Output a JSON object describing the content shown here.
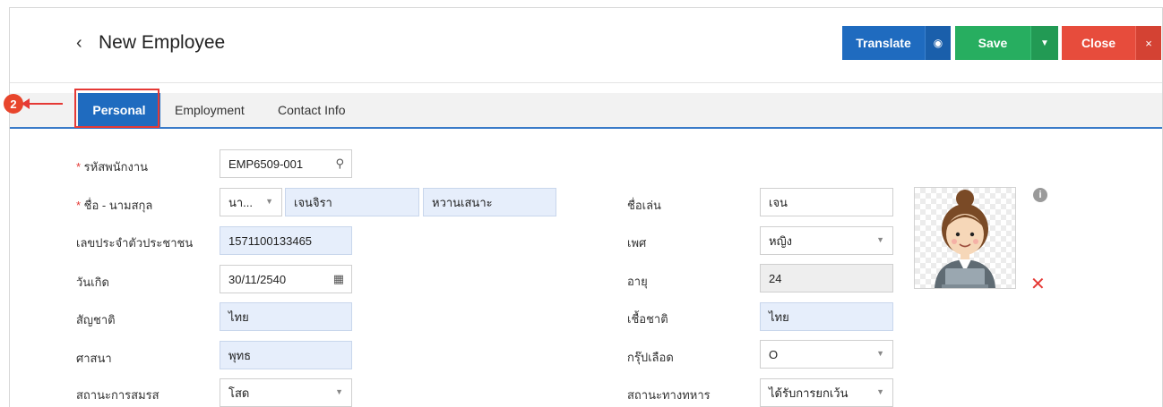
{
  "header": {
    "back_icon": "‹",
    "title": "New Employee",
    "translate_label": "Translate",
    "globe_icon": "◉",
    "save_label": "Save",
    "save_caret": "▼",
    "close_label": "Close",
    "close_x": "×"
  },
  "step_marker": "2",
  "tabs": [
    "Personal",
    "Employment",
    "Contact Info"
  ],
  "form": {
    "emp_code": {
      "label": "รหัสพนักงาน",
      "value": "EMP6509-001"
    },
    "name": {
      "label": "ชื่อ - นามสกุล",
      "prefix": "นา...",
      "first": "เจนจิรา",
      "last": "หวานเสนาะ"
    },
    "id_no": {
      "label": "เลขประจำตัวประชาชน",
      "value": "1571100133465"
    },
    "birth": {
      "label": "วันเกิด",
      "value": "30/11/2540"
    },
    "nationality": {
      "label": "สัญชาติ",
      "value": "ไทย"
    },
    "religion": {
      "label": "ศาสนา",
      "value": "พุทธ"
    },
    "marital": {
      "label": "สถานะการสมรส",
      "value": "โสด"
    },
    "nickname": {
      "label": "ชื่อเล่น",
      "value": "เจน"
    },
    "gender": {
      "label": "เพศ",
      "value": "หญิง"
    },
    "age": {
      "label": "อายุ",
      "value": "24"
    },
    "ethnicity": {
      "label": "เชื้อชาติ",
      "value": "ไทย"
    },
    "blood": {
      "label": "กรุ๊ปเลือด",
      "value": "O"
    },
    "military": {
      "label": "สถานะทางทหาร",
      "value": "ได้รับการยกเว้น"
    }
  },
  "icons": {
    "search": "search-icon",
    "calendar": "calendar-icon",
    "dropdown": "chevron-down-icon",
    "info": "info-icon",
    "remove": "close-icon"
  },
  "colors": {
    "primary": "#1f6bbf",
    "save": "#27ae60",
    "close": "#e74c3c",
    "highlight": "#e53935"
  }
}
